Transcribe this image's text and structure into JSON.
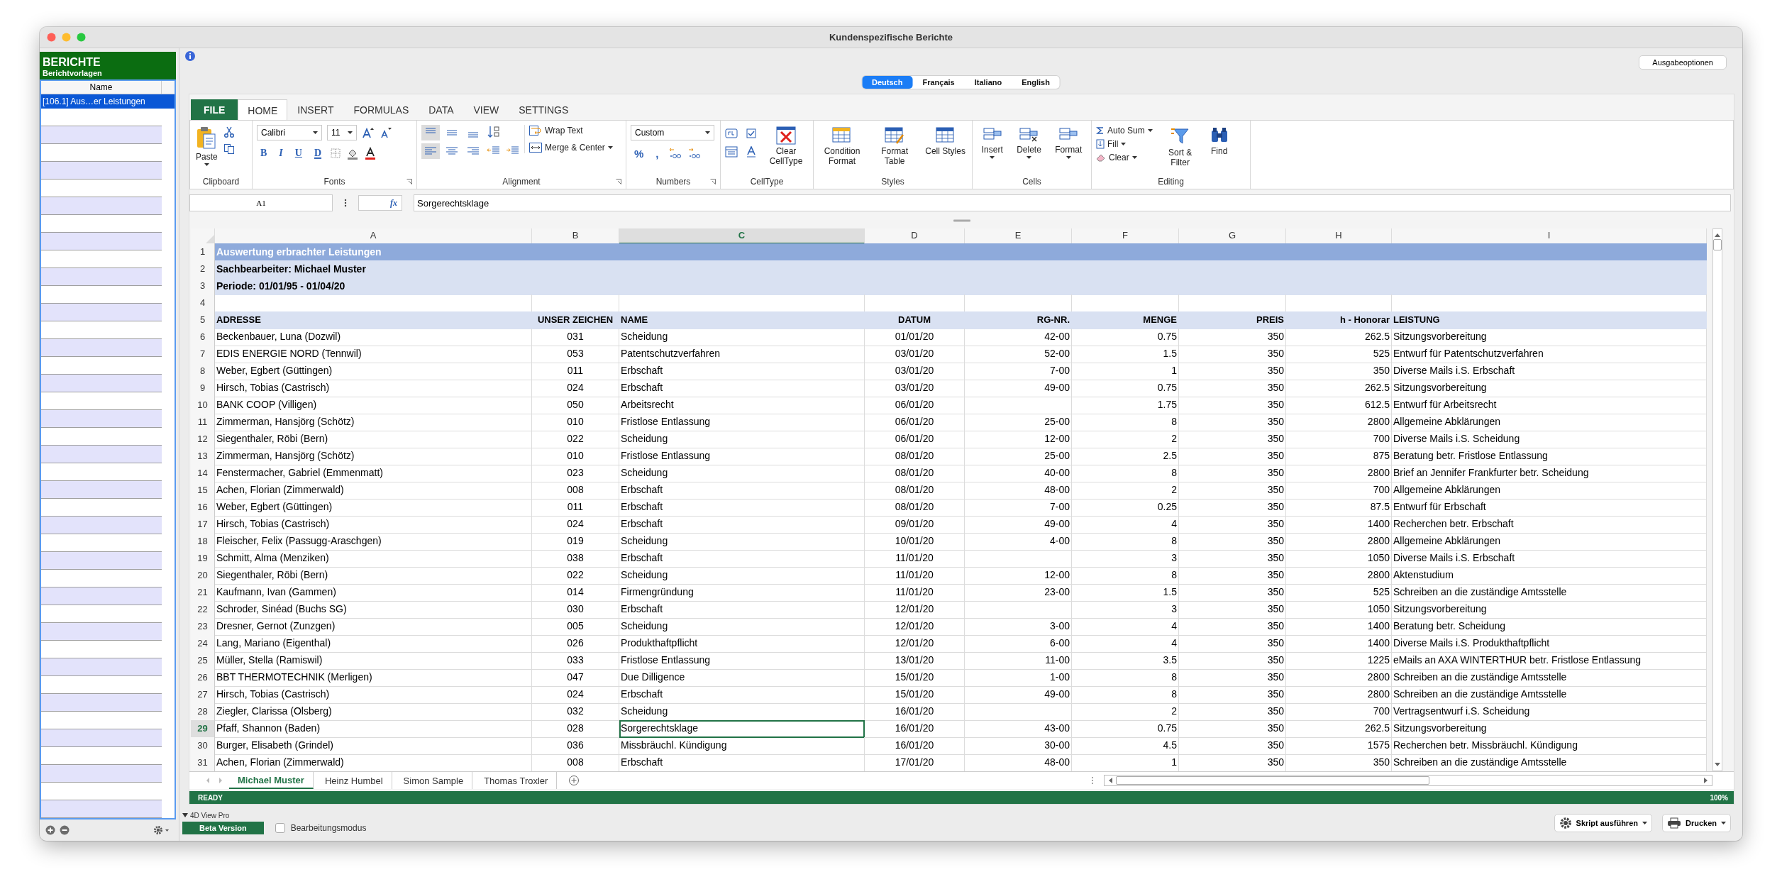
{
  "window": {
    "title": "Kundenspezifische Berichte"
  },
  "sidebar": {
    "title": "BERICHTE",
    "subtitle": "Berichtvorlagen",
    "column": "Name",
    "items": [
      {
        "label": "[106.1] Aus…er Leistungen",
        "selected": true
      }
    ]
  },
  "output_options_button": "Ausgabeoptionen",
  "languages": [
    {
      "label": "Deutsch",
      "selected": true
    },
    {
      "label": "Français",
      "selected": false
    },
    {
      "label": "Italiano",
      "selected": false
    },
    {
      "label": "English",
      "selected": false
    }
  ],
  "ribbon": {
    "tabs": [
      {
        "label": "FILE",
        "kind": "file",
        "selected": false
      },
      {
        "label": "HOME",
        "kind": "tab",
        "selected": true
      },
      {
        "label": "INSERT",
        "kind": "tab",
        "selected": false
      },
      {
        "label": "FORMULAS",
        "kind": "tab",
        "selected": false
      },
      {
        "label": "DATA",
        "kind": "tab",
        "selected": false
      },
      {
        "label": "VIEW",
        "kind": "tab",
        "selected": false
      },
      {
        "label": "SETTINGS",
        "kind": "tab",
        "selected": false
      }
    ],
    "clipboard": {
      "label": "Clipboard",
      "paste": "Paste"
    },
    "fonts": {
      "label": "Fonts",
      "font": "Calibri",
      "size": "11",
      "bold": "B",
      "italic": "I",
      "underline": "U",
      "double_underline": "D"
    },
    "alignment": {
      "label": "Alignment",
      "wrap": "Wrap Text",
      "merge": "Merge & Center"
    },
    "numbers": {
      "label": "Numbers",
      "format": "Custom",
      "percent": "%",
      "comma": ","
    },
    "celltype": {
      "label": "CellType",
      "clear": "Clear CellType"
    },
    "styles": {
      "label": "Styles",
      "buttons": [
        "Condition Format",
        "Format Table",
        "Cell Styles"
      ]
    },
    "cells": {
      "label": "Cells",
      "buttons": [
        "Insert",
        "Delete",
        "Format"
      ]
    },
    "editing": {
      "label": "Editing",
      "auto_sum": "Auto Sum",
      "fill": "Fill",
      "clear": "Clear",
      "sort": "Sort & Filter",
      "find": "Find"
    }
  },
  "formula_bar": {
    "cell": "A1",
    "fx": "fx",
    "value": "Sorgerechtsklage"
  },
  "grid": {
    "columns": [
      {
        "label": "A",
        "selected": false
      },
      {
        "label": "B",
        "selected": false
      },
      {
        "label": "C",
        "selected": true
      },
      {
        "label": "D",
        "selected": false
      },
      {
        "label": "E",
        "selected": false
      },
      {
        "label": "F",
        "selected": false
      },
      {
        "label": "G",
        "selected": false
      },
      {
        "label": "H",
        "selected": false
      },
      {
        "label": "I",
        "selected": false
      }
    ],
    "rows": [
      {
        "number": "1",
        "kind": "title",
        "selected": false,
        "text": "Auswertung erbrachter Leistungen"
      },
      {
        "number": "2",
        "kind": "subtitle",
        "selected": false,
        "text": "Sachbearbeiter: Michael Muster"
      },
      {
        "number": "3",
        "kind": "subtitle",
        "selected": false,
        "text": "Periode: 01/01/95 - 01/04/20"
      },
      {
        "number": "4",
        "kind": "blank",
        "selected": false
      },
      {
        "number": "5",
        "kind": "header",
        "selected": false,
        "cells": [
          "ADRESSE",
          "UNSER ZEICHEN",
          "NAME",
          "DATUM",
          "RG-NR.",
          "MENGE",
          "PREIS",
          "h - Honorar",
          "LEISTUNG"
        ]
      },
      {
        "number": "6",
        "kind": "data",
        "selected": false,
        "cells": [
          "Beckenbauer, Luna (Dozwil)",
          "031",
          "Scheidung",
          "01/01/20",
          "42-00",
          "0.75",
          "350",
          "262.5",
          "Sitzungsvorbereitung"
        ]
      },
      {
        "number": "7",
        "kind": "data",
        "selected": false,
        "cells": [
          "EDIS ENERGIE NORD (Tennwil)",
          "053",
          "Patentschutzverfahren",
          "03/01/20",
          "52-00",
          "1.5",
          "350",
          "525",
          "Entwurf für Patentschutzverfahren"
        ]
      },
      {
        "number": "8",
        "kind": "data",
        "selected": false,
        "cells": [
          "Weber, Egbert (Güttingen)",
          "011",
          "Erbschaft",
          "03/01/20",
          "7-00",
          "1",
          "350",
          "350",
          "Diverse Mails i.S. Erbschaft"
        ]
      },
      {
        "number": "9",
        "kind": "data",
        "selected": false,
        "cells": [
          "Hirsch, Tobias (Castrisch)",
          "024",
          "Erbschaft",
          "03/01/20",
          "49-00",
          "0.75",
          "350",
          "262.5",
          "Sitzungsvorbereitung"
        ]
      },
      {
        "number": "10",
        "kind": "data",
        "selected": false,
        "cells": [
          "BANK COOP (Villigen)",
          "050",
          "Arbeitsrecht",
          "06/01/20",
          null,
          "1.75",
          "350",
          "612.5",
          "Entwurf für Arbeitsrecht"
        ]
      },
      {
        "number": "11",
        "kind": "data",
        "selected": false,
        "cells": [
          "Zimmerman, Hansjörg (Schötz)",
          "010",
          "Fristlose Entlassung",
          "06/01/20",
          "25-00",
          "8",
          "350",
          "2800",
          "Allgemeine Abklärungen"
        ]
      },
      {
        "number": "12",
        "kind": "data",
        "selected": false,
        "cells": [
          "Siegenthaler, Röbi (Bern)",
          "022",
          "Scheidung",
          "06/01/20",
          "12-00",
          "2",
          "350",
          "700",
          "Diverse Mails i.S. Scheidung"
        ]
      },
      {
        "number": "13",
        "kind": "data",
        "selected": false,
        "cells": [
          "Zimmerman, Hansjörg (Schötz)",
          "010",
          "Fristlose Entlassung",
          "08/01/20",
          "25-00",
          "2.5",
          "350",
          "875",
          "Beratung betr. Fristlose Entlassung"
        ]
      },
      {
        "number": "14",
        "kind": "data",
        "selected": false,
        "cells": [
          "Fenstermacher, Gabriel (Emmenmatt)",
          "023",
          "Scheidung",
          "08/01/20",
          "40-00",
          "8",
          "350",
          "2800",
          "Brief an Jennifer Frankfurter betr. Scheidung"
        ]
      },
      {
        "number": "15",
        "kind": "data",
        "selected": false,
        "cells": [
          "Achen, Florian (Zimmerwald)",
          "008",
          "Erbschaft",
          "08/01/20",
          "48-00",
          "2",
          "350",
          "700",
          "Allgemeine Abklärungen"
        ]
      },
      {
        "number": "16",
        "kind": "data",
        "selected": false,
        "cells": [
          "Weber, Egbert (Güttingen)",
          "011",
          "Erbschaft",
          "08/01/20",
          "7-00",
          "0.25",
          "350",
          "87.5",
          "Entwurf für Erbschaft"
        ]
      },
      {
        "number": "17",
        "kind": "data",
        "selected": false,
        "cells": [
          "Hirsch, Tobias (Castrisch)",
          "024",
          "Erbschaft",
          "09/01/20",
          "49-00",
          "4",
          "350",
          "1400",
          "Recherchen betr. Erbschaft"
        ]
      },
      {
        "number": "18",
        "kind": "data",
        "selected": false,
        "cells": [
          "Fleischer, Felix (Passugg-Araschgen)",
          "019",
          "Scheidung",
          "10/01/20",
          "4-00",
          "8",
          "350",
          "2800",
          "Allgemeine Abklärungen"
        ]
      },
      {
        "number": "19",
        "kind": "data",
        "selected": false,
        "cells": [
          "Schmitt, Alma (Menziken)",
          "038",
          "Erbschaft",
          "11/01/20",
          null,
          "3",
          "350",
          "1050",
          "Diverse Mails i.S. Erbschaft"
        ]
      },
      {
        "number": "20",
        "kind": "data",
        "selected": false,
        "cells": [
          "Siegenthaler, Röbi (Bern)",
          "022",
          "Scheidung",
          "11/01/20",
          "12-00",
          "8",
          "350",
          "2800",
          "Aktenstudium"
        ]
      },
      {
        "number": "21",
        "kind": "data",
        "selected": false,
        "cells": [
          "Kaufmann, Ivan (Gammen)",
          "014",
          "Firmengründung",
          "11/01/20",
          "23-00",
          "1.5",
          "350",
          "525",
          "Schreiben an die zuständige Amtsstelle"
        ]
      },
      {
        "number": "22",
        "kind": "data",
        "selected": false,
        "cells": [
          "Schroder, Sinéad (Buchs SG)",
          "030",
          "Erbschaft",
          "12/01/20",
          null,
          "3",
          "350",
          "1050",
          "Sitzungsvorbereitung"
        ]
      },
      {
        "number": "23",
        "kind": "data",
        "selected": false,
        "cells": [
          "Dresner, Gernot (Zunzgen)",
          "005",
          "Scheidung",
          "12/01/20",
          "3-00",
          "4",
          "350",
          "1400",
          "Beratung betr. Scheidung"
        ]
      },
      {
        "number": "24",
        "kind": "data",
        "selected": false,
        "cells": [
          "Lang, Mariano (Eigenthal)",
          "026",
          "Produkthaftpflicht",
          "12/01/20",
          "6-00",
          "4",
          "350",
          "1400",
          "Diverse Mails i.S. Produkthaftpflicht"
        ]
      },
      {
        "number": "25",
        "kind": "data",
        "selected": false,
        "cells": [
          "Müller, Stella (Ramiswil)",
          "033",
          "Fristlose Entlassung",
          "13/01/20",
          "11-00",
          "3.5",
          "350",
          "1225",
          "eMails an AXA WINTERTHUR betr. Fristlose Entlassung"
        ]
      },
      {
        "number": "26",
        "kind": "data",
        "selected": false,
        "cells": [
          "BBT THERMOTECHNIK (Merligen)",
          "047",
          "Due Dilligence",
          "15/01/20",
          "1-00",
          "8",
          "350",
          "2800",
          "Schreiben an die zuständige Amtsstelle"
        ]
      },
      {
        "number": "27",
        "kind": "data",
        "selected": false,
        "cells": [
          "Hirsch, Tobias (Castrisch)",
          "024",
          "Erbschaft",
          "15/01/20",
          "49-00",
          "8",
          "350",
          "2800",
          "Schreiben an die zuständige Amtsstelle"
        ]
      },
      {
        "number": "28",
        "kind": "data",
        "selected": false,
        "cells": [
          "Ziegler, Clarissa (Olsberg)",
          "032",
          "Scheidung",
          "16/01/20",
          null,
          "2",
          "350",
          "700",
          "Vertragsentwurf i.S. Scheidung"
        ]
      },
      {
        "number": "29",
        "kind": "data",
        "selected": true,
        "cells": [
          "Pfaff, Shannon (Baden)",
          "028",
          "Sorgerechtsklage",
          "16/01/20",
          "43-00",
          "0.75",
          "350",
          "262.5",
          "Sitzungsvorbereitung"
        ]
      },
      {
        "number": "30",
        "kind": "data",
        "selected": false,
        "cells": [
          "Burger, Elisabeth (Grindel)",
          "036",
          "Missbräuchl. Kündigung",
          "16/01/20",
          "30-00",
          "4.5",
          "350",
          "1575",
          "Recherchen betr. Missbräuchl. Kündigung"
        ]
      },
      {
        "number": "31",
        "kind": "data",
        "selected": false,
        "cells": [
          "Achen, Florian (Zimmerwald)",
          "008",
          "Erbschaft",
          "17/01/20",
          "48-00",
          "1",
          "350",
          "350",
          "Schreiben an die zuständige Amtsstelle"
        ]
      }
    ]
  },
  "sheet_tabs": [
    {
      "label": "Michael Muster",
      "selected": true
    },
    {
      "label": "Heinz Humbel",
      "selected": false
    },
    {
      "label": "Simon Sample",
      "selected": false
    },
    {
      "label": "Thomas Troxler",
      "selected": false
    }
  ],
  "status_bar": {
    "state": "READY",
    "zoom": "100%"
  },
  "footer": {
    "section": "4D View Pro",
    "expanded": true,
    "badge": "Beta Version",
    "edit_mode": {
      "label": "Bearbeitungsmodus",
      "checked": false
    },
    "buttons": [
      "Skript ausführen",
      "Drucken"
    ]
  }
}
